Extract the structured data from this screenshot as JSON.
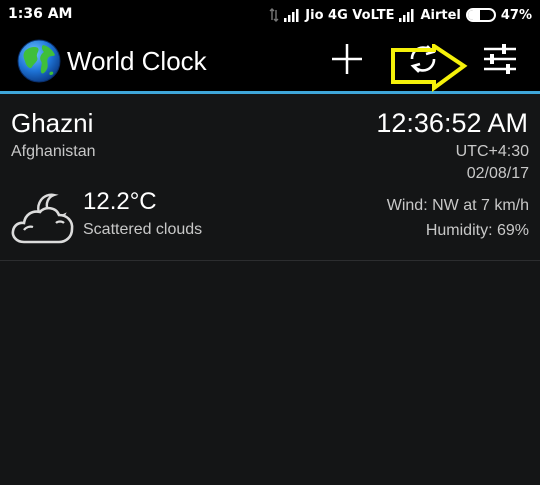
{
  "status_bar": {
    "time": "1:36 AM",
    "carrier_1": "Jio 4G VoLTE",
    "carrier_2": "Airtel",
    "battery_percent_text": "47%",
    "battery_level": 0.47
  },
  "action_bar": {
    "app_title": "World Clock",
    "icons": [
      "globe-icon",
      "plus-icon",
      "refresh-icon",
      "sliders-icon"
    ],
    "accent_color": "#3fa6d9",
    "annotation_arrow_color": "#f5f10a"
  },
  "city": {
    "name": "Ghazni",
    "country": "Afghanistan",
    "time": "12:36:52 AM",
    "utc_offset": "UTC+4:30",
    "date": "02/08/17",
    "weather": {
      "icon": "night-cloud-moon-icon",
      "temperature": "12.2°C",
      "description": "Scattered clouds",
      "wind": "Wind: NW at 7 km/h",
      "humidity": "Humidity: 69%"
    }
  }
}
